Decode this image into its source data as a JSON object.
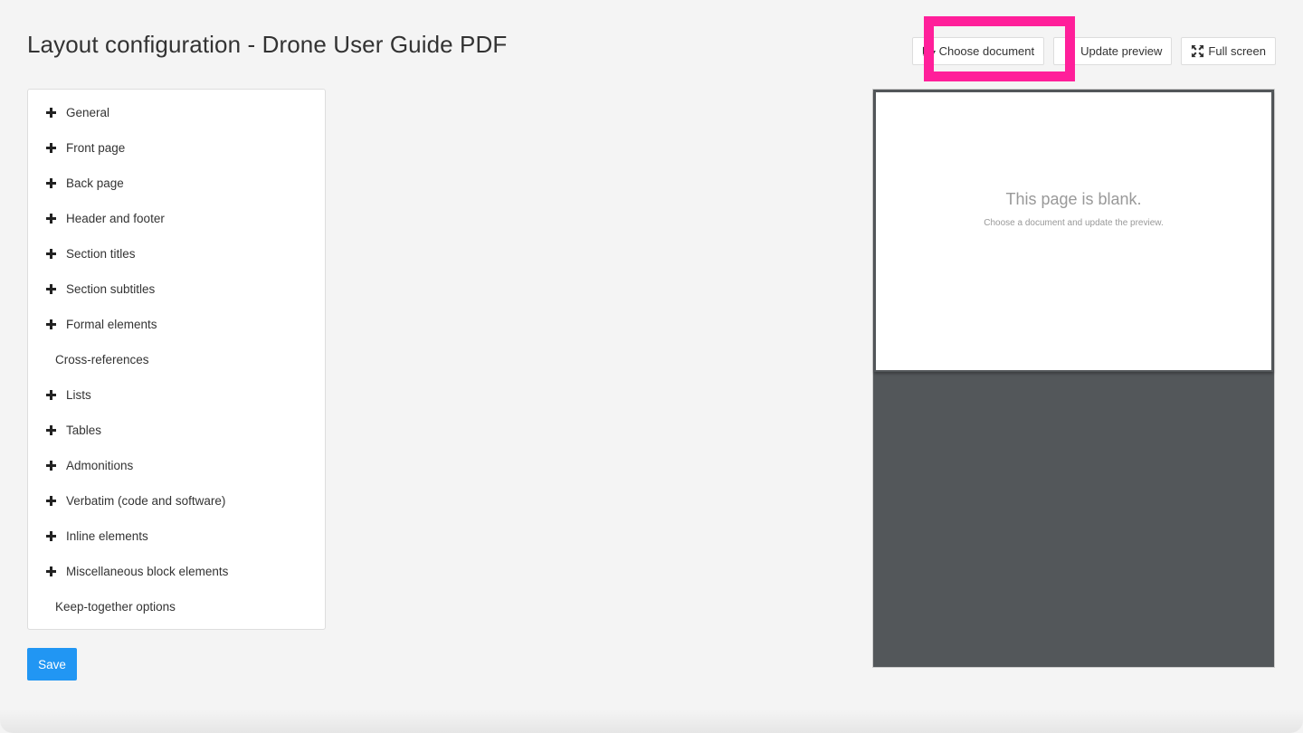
{
  "header": {
    "title": "Layout configuration - Drone User Guide PDF"
  },
  "toolbar": {
    "choose_document": {
      "label": "Choose document",
      "icon": "folder-open-icon"
    },
    "update_preview": {
      "label": "Update preview",
      "icon": "refresh-icon"
    },
    "full_screen": {
      "label": "Full screen",
      "icon": "expand-icon"
    }
  },
  "highlight_color": "#ff1f9a",
  "sections": [
    {
      "label": "General",
      "expandable": true
    },
    {
      "label": "Front page",
      "expandable": true
    },
    {
      "label": "Back page",
      "expandable": true
    },
    {
      "label": "Header and footer",
      "expandable": true
    },
    {
      "label": "Section titles",
      "expandable": true
    },
    {
      "label": "Section subtitles",
      "expandable": true
    },
    {
      "label": "Formal elements",
      "expandable": true
    },
    {
      "label": "Cross-references",
      "expandable": false
    },
    {
      "label": "Lists",
      "expandable": true
    },
    {
      "label": "Tables",
      "expandable": true
    },
    {
      "label": "Admonitions",
      "expandable": true
    },
    {
      "label": "Verbatim (code and software)",
      "expandable": true
    },
    {
      "label": "Inline elements",
      "expandable": true
    },
    {
      "label": "Miscellaneous block elements",
      "expandable": true
    },
    {
      "label": "Keep-together options",
      "expandable": false
    }
  ],
  "save": {
    "label": "Save",
    "color": "#2196f3"
  },
  "preview": {
    "title": "This page is blank.",
    "subtitle": "Choose a document and update the preview."
  }
}
